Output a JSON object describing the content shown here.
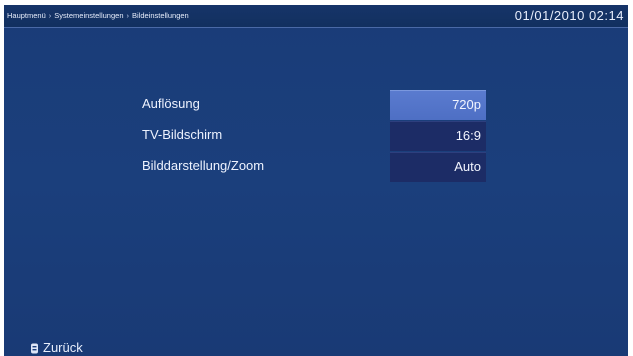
{
  "header": {
    "breadcrumb": [
      "Hauptmenü",
      "Systemeinstellungen",
      "Bildeinstellungen"
    ],
    "separator": "›",
    "datetime": "01/01/2010  02:14"
  },
  "settings": [
    {
      "label": "Auflösung",
      "value": "720p",
      "selected": true
    },
    {
      "label": "TV-Bildschirm",
      "value": "16:9",
      "selected": false
    },
    {
      "label": "Bilddarstellung/Zoom",
      "value": "Auto",
      "selected": false
    }
  ],
  "footer": {
    "back_icon": "remote-back-button-icon",
    "back_label": "Zurück"
  },
  "colors": {
    "background": "#1b3f7c",
    "selected_value": "#5a7bcf",
    "value_box": "#1c2c66",
    "text": "#eef3ff"
  }
}
